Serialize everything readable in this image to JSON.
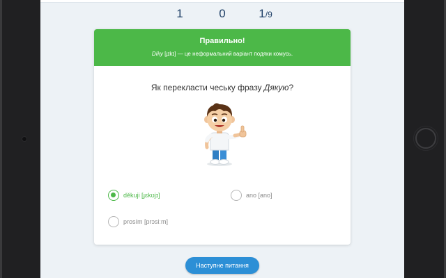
{
  "scoreboard": {
    "correct": "1",
    "wrong": "0",
    "current": "1",
    "separator": "/",
    "total": "9"
  },
  "feedback": {
    "title": "Правильно!",
    "word": "Díky",
    "pronunciation": "[ɟɪkɪ]",
    "explanation": "— це неформальний варіант подяки комусь."
  },
  "question": {
    "prefix": "Як перекласти чеську фразу ",
    "phrase": "Дякую",
    "suffix": "?"
  },
  "options": [
    {
      "text": "děkuji [ɟɛkʊjɪ]",
      "selected": true
    },
    {
      "text": "ano [ano]",
      "selected": false
    },
    {
      "text": "prosím [prɔsiːm]",
      "selected": false
    }
  ],
  "next_button": {
    "label": "Наступне питання"
  },
  "colors": {
    "correct_green": "#4cb848",
    "button_blue": "#2c8fd6",
    "score_navy": "#1e3f66",
    "screen_bg": "#edf2f6"
  },
  "icons": [
    "thumbs-up-mascot"
  ]
}
